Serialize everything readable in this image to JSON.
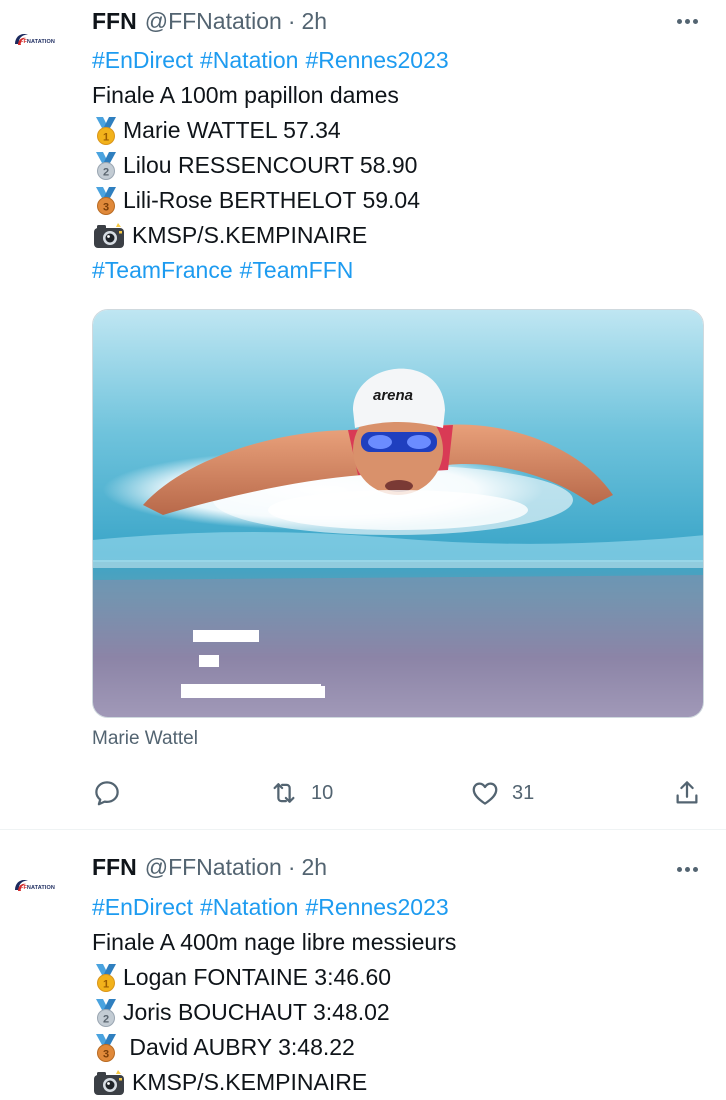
{
  "colors": {
    "link": "#1d9bf0",
    "secondary": "#536471",
    "text": "#0f1419",
    "gold": "#f2b21b",
    "silver": "#9aa6b2",
    "bronze": "#d9822b",
    "ribbon": "#4aa3df"
  },
  "tweets": [
    {
      "avatar_brand_ff": "FF",
      "avatar_brand_rest": "NATATION",
      "name": "FFN",
      "handle": "@FFNatation",
      "separator": "·",
      "time": "2h",
      "hashtags": [
        "#EnDirect",
        "#Natation",
        "#Rennes2023"
      ],
      "title": "Finale A 100m papillon dames",
      "results": [
        {
          "medal": "gold-medal-icon",
          "text": "Marie WATTEL 57.34"
        },
        {
          "medal": "silver-medal-icon",
          "text": "Lilou RESSENCOURT 58.90"
        },
        {
          "medal": "bronze-medal-icon",
          "text": "Lili-Rose BERTHELOT 59.04"
        }
      ],
      "credit_icon": "camera-flash-icon",
      "credit": "KMSP/S.KEMPINAIRE",
      "footer_tags": [
        "#TeamFrance",
        "#TeamFFN"
      ],
      "media": {
        "cap_brand": "arena",
        "alt": "Marie Wattel"
      },
      "actions": {
        "reply_icon": "reply-icon",
        "retweet_icon": "retweet-icon",
        "retweets": "10",
        "like_icon": "heart-icon",
        "likes": "31",
        "share_icon": "share-icon"
      }
    },
    {
      "avatar_brand_ff": "FF",
      "avatar_brand_rest": "NATATION",
      "name": "FFN",
      "handle": "@FFNatation",
      "separator": "·",
      "time": "2h",
      "hashtags": [
        "#EnDirect",
        "#Natation",
        "#Rennes2023"
      ],
      "title": "Finale A 400m nage libre messieurs",
      "results": [
        {
          "medal": "gold-medal-icon",
          "text": "Logan FONTAINE 3:46.60"
        },
        {
          "medal": "silver-medal-icon",
          "text": "Joris BOUCHAUT 3:48.02"
        },
        {
          "medal": "bronze-medal-icon",
          "text": " David AUBRY 3:48.22"
        }
      ],
      "credit_icon": "camera-flash-icon",
      "credit": "KMSP/S.KEMPINAIRE"
    }
  ]
}
